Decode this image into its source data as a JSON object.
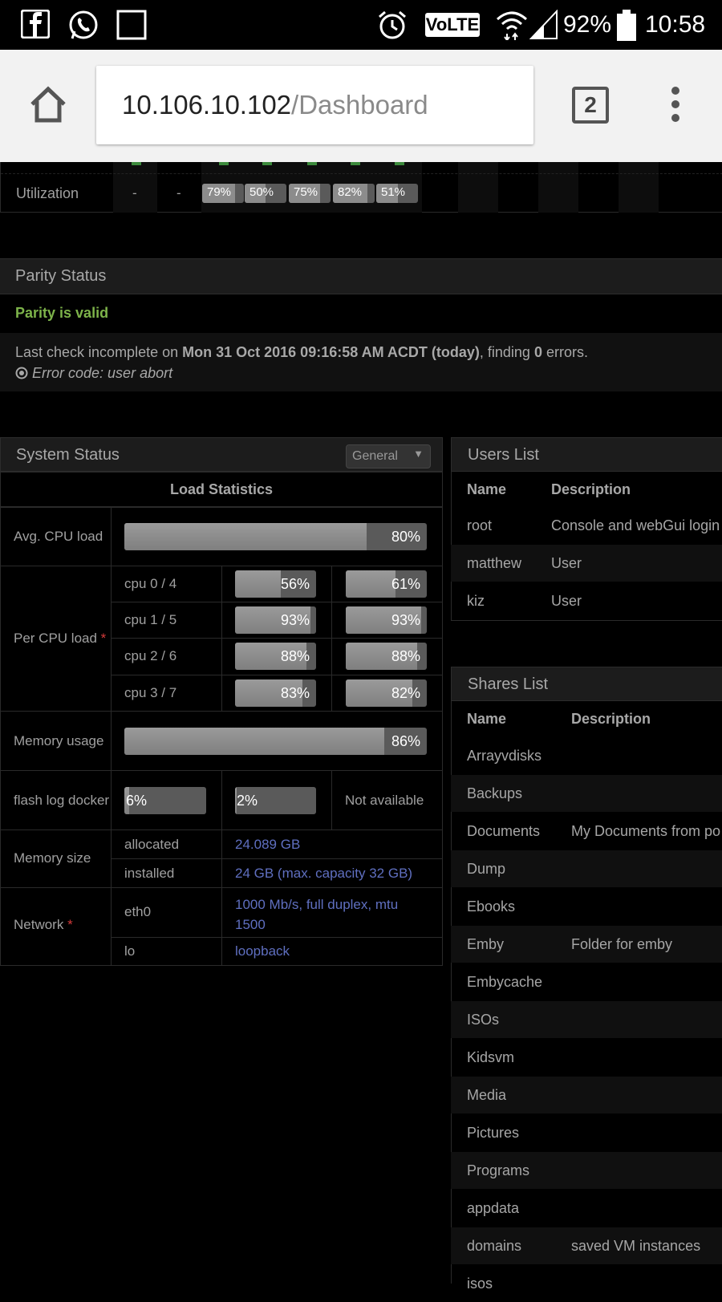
{
  "statusbar": {
    "icons": [
      "facebook-icon",
      "whatsapp-icon",
      "image-icon",
      "alarm-icon",
      "wifi-icon",
      "signal-icon",
      "battery-icon"
    ],
    "volte": "VoLTE",
    "battery": "92%",
    "time": "10:58"
  },
  "browser": {
    "host": "10.106.10.102",
    "path": "/Dashboard",
    "tab_count": "2"
  },
  "utilization": {
    "label": "Utilization",
    "dashes": [
      "-",
      "-"
    ],
    "disks": [
      {
        "text": "79%",
        "value": 79
      },
      {
        "text": "50%",
        "value": 50
      },
      {
        "text": "75%",
        "value": 75
      },
      {
        "text": "82%",
        "value": 82
      },
      {
        "text": "51%",
        "value": 51
      }
    ]
  },
  "parity": {
    "title": "Parity Status",
    "status": "Parity is valid",
    "check_prefix": "Last check incomplete on ",
    "check_date": "Mon 31 Oct 2016 09:16:58 AM ACDT (today)",
    "check_mid": ", finding ",
    "check_errors": "0",
    "check_suffix": " errors.",
    "error_code": "Error code: user abort"
  },
  "system": {
    "title": "System Status",
    "dropdown": "General",
    "load_header": "Load Statistics",
    "avg_label": "Avg. CPU load",
    "avg": {
      "text": "80%",
      "value": 80
    },
    "per_cpu_label": "Per CPU load",
    "asterisk": "*",
    "cpus": [
      {
        "name": "cpu 0 / 4",
        "a": {
          "text": "56%",
          "value": 56
        },
        "b": {
          "text": "61%",
          "value": 61
        }
      },
      {
        "name": "cpu 1 / 5",
        "a": {
          "text": "93%",
          "value": 93
        },
        "b": {
          "text": "93%",
          "value": 93
        }
      },
      {
        "name": "cpu 2 / 6",
        "a": {
          "text": "88%",
          "value": 88
        },
        "b": {
          "text": "88%",
          "value": 88
        }
      },
      {
        "name": "cpu 3 / 7",
        "a": {
          "text": "83%",
          "value": 83
        },
        "b": {
          "text": "82%",
          "value": 82
        }
      }
    ],
    "memory_label": "Memory usage",
    "memory": {
      "text": "86%",
      "value": 86
    },
    "flash_label": "flash log docker",
    "flash": {
      "text": "6%",
      "value": 6
    },
    "log": {
      "text": "2%",
      "value": 2
    },
    "docker": "Not available",
    "memsize_label": "Memory size",
    "allocated_label": "allocated",
    "allocated": "24.089 GB",
    "installed_label": "installed",
    "installed": "24 GB (max. capacity 32 GB)",
    "network_label": "Network",
    "eth0_label": "eth0",
    "eth0_line1": "1000 Mb/s, full duplex, mtu",
    "eth0_line2": "1500",
    "lo_label": "lo",
    "lo": "loopback"
  },
  "users": {
    "title": "Users List",
    "col_name": "Name",
    "col_desc": "Description",
    "rows": [
      {
        "name": "root",
        "desc": "Console and webGui login"
      },
      {
        "name": "matthew",
        "desc": "User"
      },
      {
        "name": "kiz",
        "desc": "User"
      }
    ]
  },
  "shares": {
    "title": "Shares List",
    "col_name": "Name",
    "col_desc": "Description",
    "rows": [
      {
        "name": "Arrayvdisks",
        "desc": ""
      },
      {
        "name": "Backups",
        "desc": ""
      },
      {
        "name": "Documents",
        "desc": "My Documents from po"
      },
      {
        "name": "Dump",
        "desc": ""
      },
      {
        "name": "Ebooks",
        "desc": ""
      },
      {
        "name": "Emby",
        "desc": "Folder for emby"
      },
      {
        "name": "Embycache",
        "desc": ""
      },
      {
        "name": "ISOs",
        "desc": ""
      },
      {
        "name": "Kidsvm",
        "desc": ""
      },
      {
        "name": "Media",
        "desc": ""
      },
      {
        "name": "Pictures",
        "desc": ""
      },
      {
        "name": "Programs",
        "desc": ""
      },
      {
        "name": "appdata",
        "desc": ""
      },
      {
        "name": "domains",
        "desc": "saved VM instances"
      },
      {
        "name": "isos",
        "desc": ""
      }
    ]
  }
}
